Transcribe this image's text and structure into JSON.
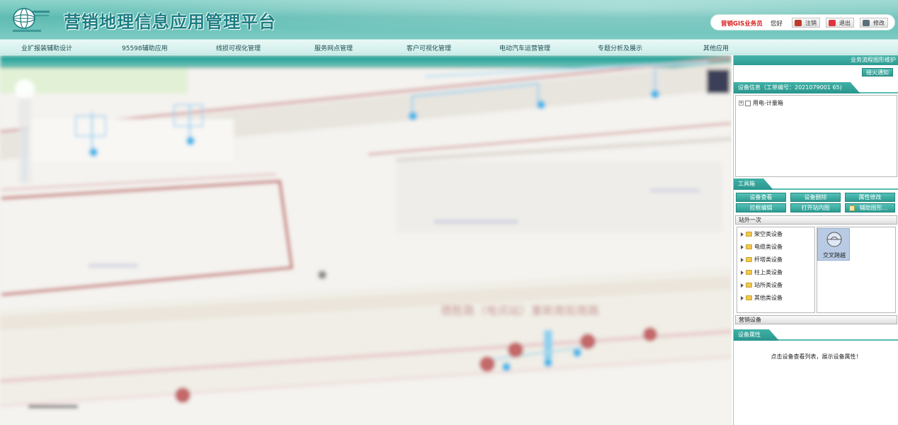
{
  "header": {
    "title": "营销地理信息应用管理平台",
    "role": "营销GIS业务员",
    "greeting": "您好",
    "buttons": [
      {
        "label": "注销",
        "icon": "logout-icon"
      },
      {
        "label": "退出",
        "icon": "exit-icon"
      },
      {
        "label": "修改",
        "icon": "edit-icon"
      }
    ]
  },
  "nav": {
    "items": [
      "业扩报装辅助设计",
      "95598辅助应用",
      "线损可视化管理",
      "服务网点管理",
      "客户可视化管理",
      "电动汽车运营管理",
      "专题分析及展示",
      "其他应用"
    ]
  },
  "map": {
    "road_label": "德胜路（电讯站）重新南街南路"
  },
  "panel": {
    "top_label": "业务流程图形维护",
    "notify_button": "接火通知",
    "device_info_title": "设备信息（工单编号：2021079001 65)",
    "device_tree_root": "用电-计量箱",
    "toolbox_title": "工具箱",
    "tools": [
      "设备查看",
      "设备删除",
      "属性修改",
      "拉框编辑",
      "打开站内图",
      "辅助图形..."
    ],
    "station_outside_title": "站外一次",
    "categories": [
      "架空类设备",
      "电缆类设备",
      "杆塔类设备",
      "柱上类设备",
      "站所类设备",
      "其他类设备"
    ],
    "selected_symbol": "交叉跨越",
    "marketing_device_title": "营销设备",
    "device_property_title": "设备属性",
    "property_hint": "点击设备查看列表，展示设备属性！"
  },
  "colors": {
    "header_teal": "#5fbcb3",
    "title_teal": "#1a7d82",
    "role_red": "#d81e1e",
    "button_teal": "#2c9c92"
  }
}
